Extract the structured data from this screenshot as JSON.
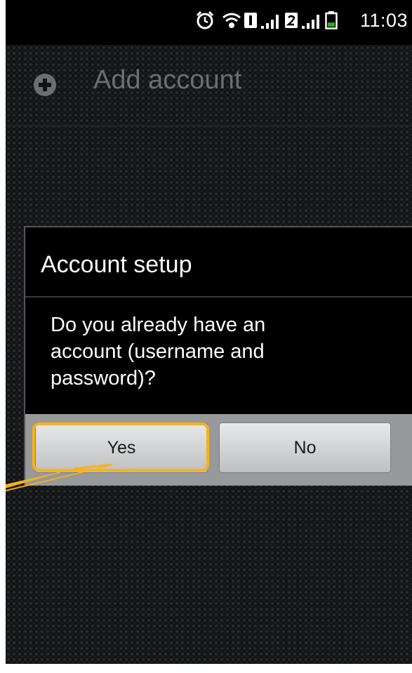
{
  "status_bar": {
    "time": "11:03",
    "icons": [
      "alarm-icon",
      "wifi-icon",
      "sim1-icon",
      "signal-icon",
      "sim2-icon",
      "signal-icon",
      "battery-icon"
    ],
    "battery_color": "#2fa82b"
  },
  "action_bar": {
    "title": "Add account",
    "icon": "add-circle-icon"
  },
  "dialog": {
    "title": "Account setup",
    "message": "Do you already have an account (username and password)?",
    "buttons": {
      "yes_label": "Yes",
      "no_label": "No"
    }
  },
  "annotation": {
    "highlight_color": "#f7b21b",
    "target": "yes-button"
  }
}
